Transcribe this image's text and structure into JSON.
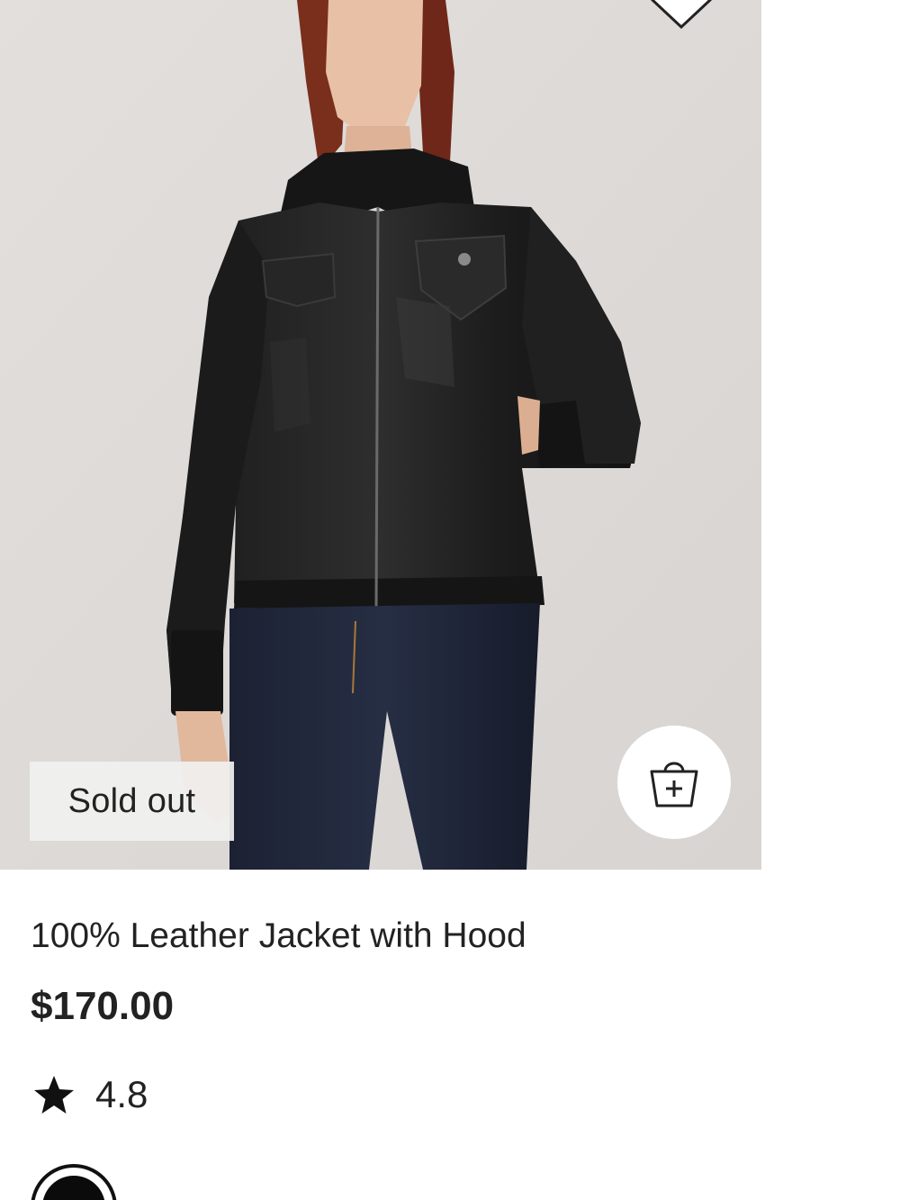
{
  "product": {
    "name": "100% Leather Jacket with Hood",
    "price": "$170.00",
    "rating": "4.8",
    "badge": "Sold out",
    "image_alt": "Model wearing black leather jacket with hood and dark jeans"
  },
  "icons": {
    "wishlist": "heart-icon",
    "add_to_bag": "shopping-bag-plus-icon",
    "rating": "star-icon"
  },
  "colors": {
    "background": "#ffffff",
    "image_bg": "#e6e3e1",
    "text": "#222222",
    "swatch_selected": "#0b0b0b"
  }
}
